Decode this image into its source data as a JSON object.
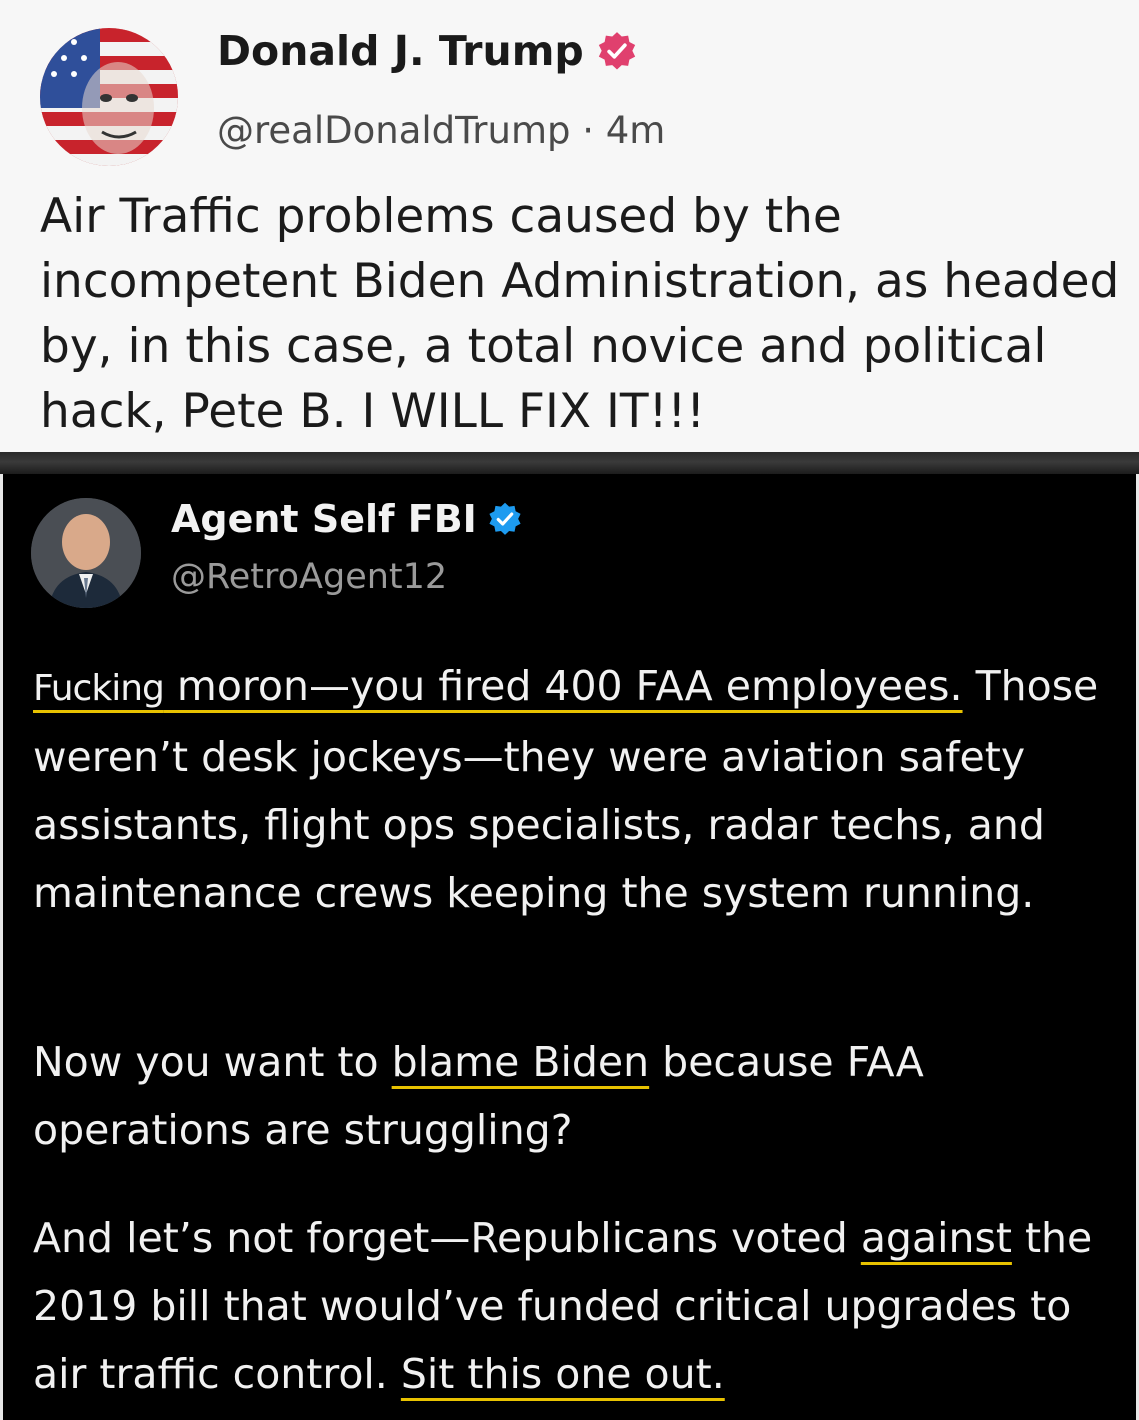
{
  "post_top": {
    "display_name": "Donald J. Trump",
    "handle_time": "@realDonaldTrump · 4m",
    "body": "Air Traffic problems caused by the incompetent Biden Administration, as headed by, in this case, a total novice and political hack, Pete B. I WILL FIX IT!!!",
    "verified_icon": "verified-badge-pink",
    "badge_color": "#e0406e"
  },
  "post_bottom": {
    "display_name": "Agent Self FBI",
    "handle": "@RetroAgent12",
    "verified_icon": "verified-badge-blue",
    "badge_color": "#1d9bf0",
    "underline_color": "#e8c200",
    "p1_censored": "Fucking",
    "p1_rest": " moron—you fired 400 FAA employees.",
    "p1_tail": " Those weren’t desk jockeys—they were aviation safety assistants, flight ops specialists, radar techs, and maintenance crews keeping the system running.",
    "p2_a": "Now you want to ",
    "p2_u": "blame Biden",
    "p2_b": " because FAA operations are struggling?",
    "p3_a": "And let’s not forget—Republicans voted ",
    "p3_u1": "against",
    "p3_b": " the 2019 bill that would’ve funded critical upgrades to air traffic control. ",
    "p3_u2": "Sit this one out."
  }
}
